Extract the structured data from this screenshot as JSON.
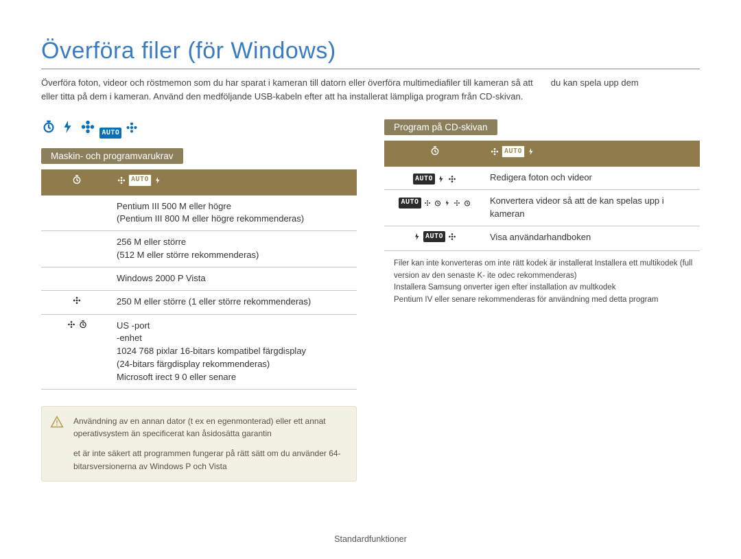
{
  "title": "Överföra filer (för Windows)",
  "intro_part_a": "Överföra foton, videor och röstmemon som du har sparat i kameran till datorn eller överföra multimediafiler till kameran så att",
  "intro_part_b": "du kan spela upp dem",
  "intro_line2": "eller titta på dem i kameran. Använd den medföljande USB-kabeln efter att ha installerat lämpliga program från CD-skivan.",
  "sections": {
    "req_tab": "Maskin- och programvarukrav",
    "prog_tab": "Program på CD-skivan"
  },
  "req_rows": [
    "Pentium III 500 M   eller högre\n(Pentium III 800 M   eller högre rekommenderas)",
    "256 M  eller större\n(512 M  eller större rekommenderas)",
    "Windows 2000    P  Vista",
    "250 M  eller större (1      eller större rekommenderas)",
    "US -port\n       -enhet\n1024 768 pixlar  16-bitars kompatibel färgdisplay\n(24-bitars färgdisplay rekommenderas)\nMicrosoft  irect   9 0 eller senare"
  ],
  "prog_rows": [
    "Redigera foton och videor",
    "Konvertera videor så att de kan spelas upp i kameran",
    "Visa användarhandboken"
  ],
  "note": {
    "p1": "Användning av en annan dator (t ex  en egenmonterad) eller ett annat operativsystem än specificerat kan åsidosätta garantin",
    "p2": "et är inte säkert att programmen fungerar på rätt sätt om du använder 64-bitarsversionerna av Windows  P och Vista"
  },
  "side_note": "Filer kan inte konverteras om inte rätt kodek är installerat  Installera ett multikodek (full version av den senaste K- ite  odec rekommenderas)\nInstallera Samsung  onverter igen efter installation av multkodek\nPentium IV eller senare rekommenderas för användning med detta program",
  "footer": "Standardfunktioner",
  "badge_text": "AUTO"
}
